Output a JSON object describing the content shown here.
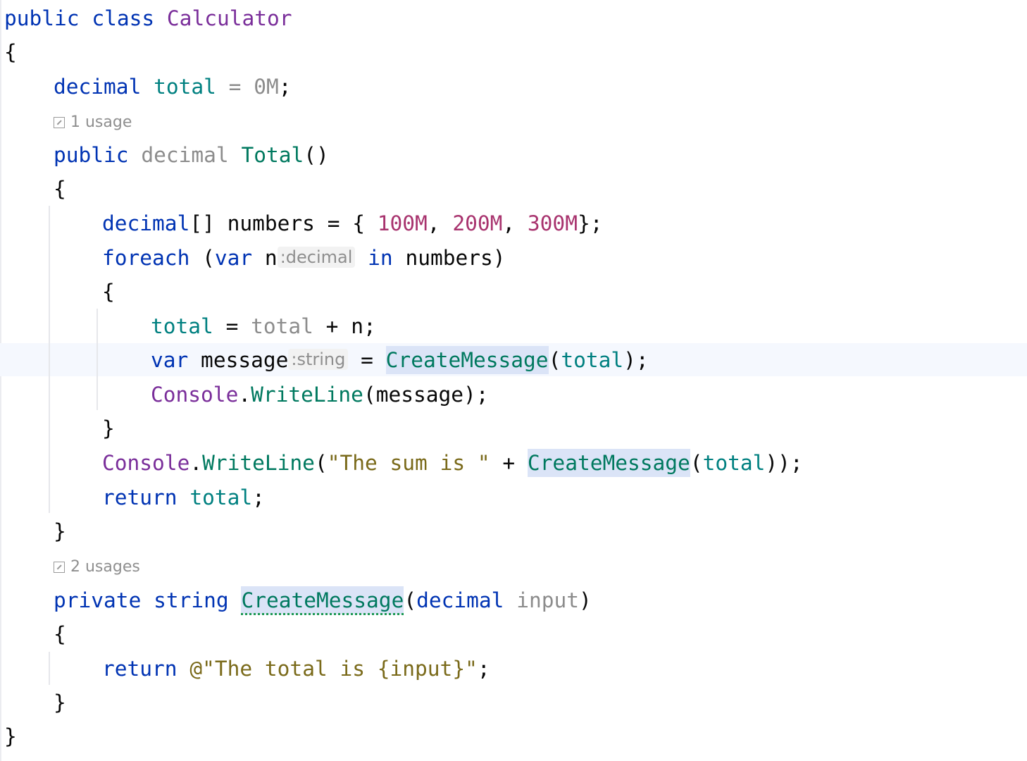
{
  "editor": {
    "line1": {
      "public": "public",
      "class": "class",
      "name": "Calculator"
    },
    "line2": {
      "brace": "{"
    },
    "line3": {
      "decimal": "decimal",
      "field": "total",
      "eq": "=",
      "value": "0M",
      "semi": ";"
    },
    "lens1": {
      "text": "1 usage"
    },
    "line4": {
      "public": "public",
      "decimal": "decimal",
      "method": "Total",
      "parens": "()"
    },
    "line5": {
      "brace": "{"
    },
    "line6": {
      "decimal": "decimal",
      "rest1": "[] numbers = { ",
      "v1": "100M",
      "c1": ", ",
      "v2": "200M",
      "c2": ", ",
      "v3": "300M",
      "end": "};"
    },
    "line7": {
      "foreach": "foreach",
      "paren": " (",
      "var": "var",
      "n": " n",
      "hint": ":decimal",
      "in": "in",
      "rest": " numbers)"
    },
    "line8": {
      "brace": "{"
    },
    "line9": {
      "total1": "total",
      "eq": " = ",
      "total2": "total",
      "rest": " + n;"
    },
    "line10": {
      "var": "var",
      "msg": " message",
      "hint": ":string",
      "eq": " = ",
      "method": "CreateMessage",
      "open": "(",
      "arg": "total",
      "close": ");"
    },
    "line11": {
      "console": "Console",
      "dot": ".",
      "method": "WriteLine",
      "rest": "(message);"
    },
    "line12": {
      "brace": "}"
    },
    "line13": {
      "console": "Console",
      "dot": ".",
      "method": "WriteLine",
      "open": "(",
      "str": "\"The sum is \"",
      "plus": " + ",
      "call": "CreateMessage",
      "open2": "(",
      "arg": "total",
      "close": "));"
    },
    "line14": {
      "return": "return",
      "val": "total",
      "semi": ";"
    },
    "line15": {
      "brace": "}"
    },
    "lens2": {
      "text": "2 usages"
    },
    "line16": {
      "private": "private",
      "string": "string",
      "method": "CreateMessage",
      "open": "(",
      "decimal": "decimal",
      "param": "input",
      "close": ")"
    },
    "line17": {
      "brace": "{"
    },
    "line18": {
      "return": "return",
      "str": "@\"The total is {input}\"",
      "semi": ";"
    },
    "line19": {
      "brace": "}"
    },
    "line20": {
      "brace": "}"
    }
  }
}
